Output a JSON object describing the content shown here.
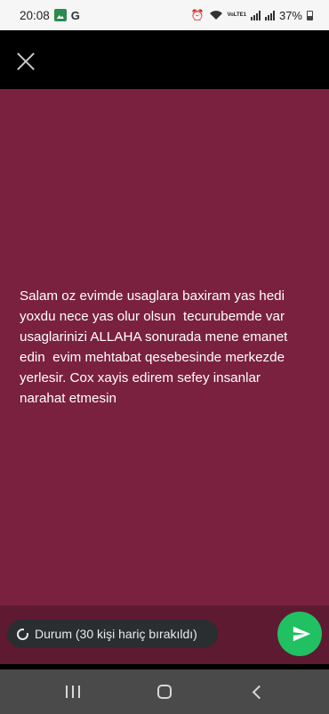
{
  "status_bar": {
    "time": "20:08",
    "battery": "37%",
    "network_label": "VoLTE1"
  },
  "composer": {
    "background_color": "#7b2140",
    "text": "Salam oz evimde usaglara baxiram yas hedi yoxdu nece yas olur olsun  tecurubemde var usaglarinizi ALLAHA sonurada mene emanet edin  evim mehtabat qesebesinde merkezde yerlesir. Cox xayis edirem sefey insanlar narahat etmesin"
  },
  "audience": {
    "label": "Durum (30 kişi hariç bırakıldı)"
  },
  "colors": {
    "send_button": "#21c063",
    "bottom_strip": "#5e1a31"
  },
  "icons": {
    "close": "close-icon",
    "send": "send-icon",
    "status": "status-ring-icon"
  }
}
